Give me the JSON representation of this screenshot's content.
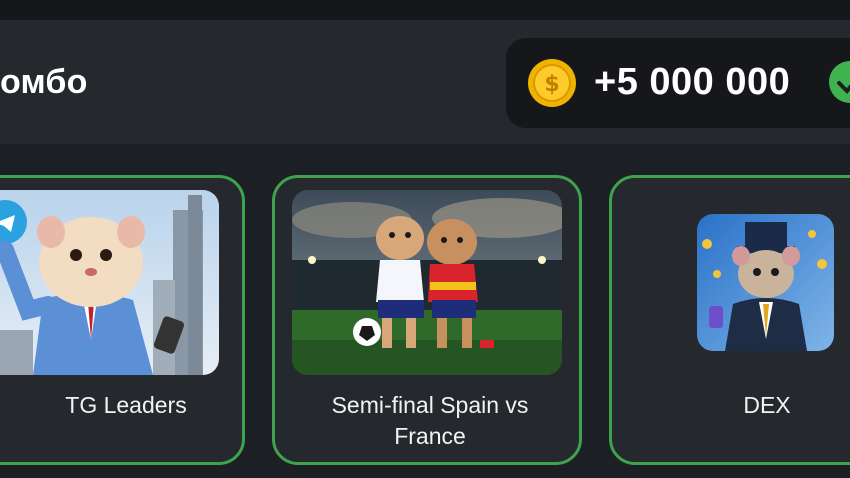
{
  "combo": {
    "title": "омбо",
    "reward_amount": "+5 000 000",
    "coin_icon": "coin-dollar-icon",
    "check_icon": "check-circle-icon"
  },
  "cards": [
    {
      "label": "TG Leaders",
      "image": "hamster-businessman-telegram-image"
    },
    {
      "label": "Semi-final Spain vs France",
      "image": "hamsters-football-stadium-image"
    },
    {
      "label": "DEX",
      "image": "hamster-top-hat-coins-image"
    }
  ],
  "colors": {
    "background": "#1c1f24",
    "panel": "#25282d",
    "accent_green": "#3fa34d",
    "coin_gold": "#f0b400"
  }
}
